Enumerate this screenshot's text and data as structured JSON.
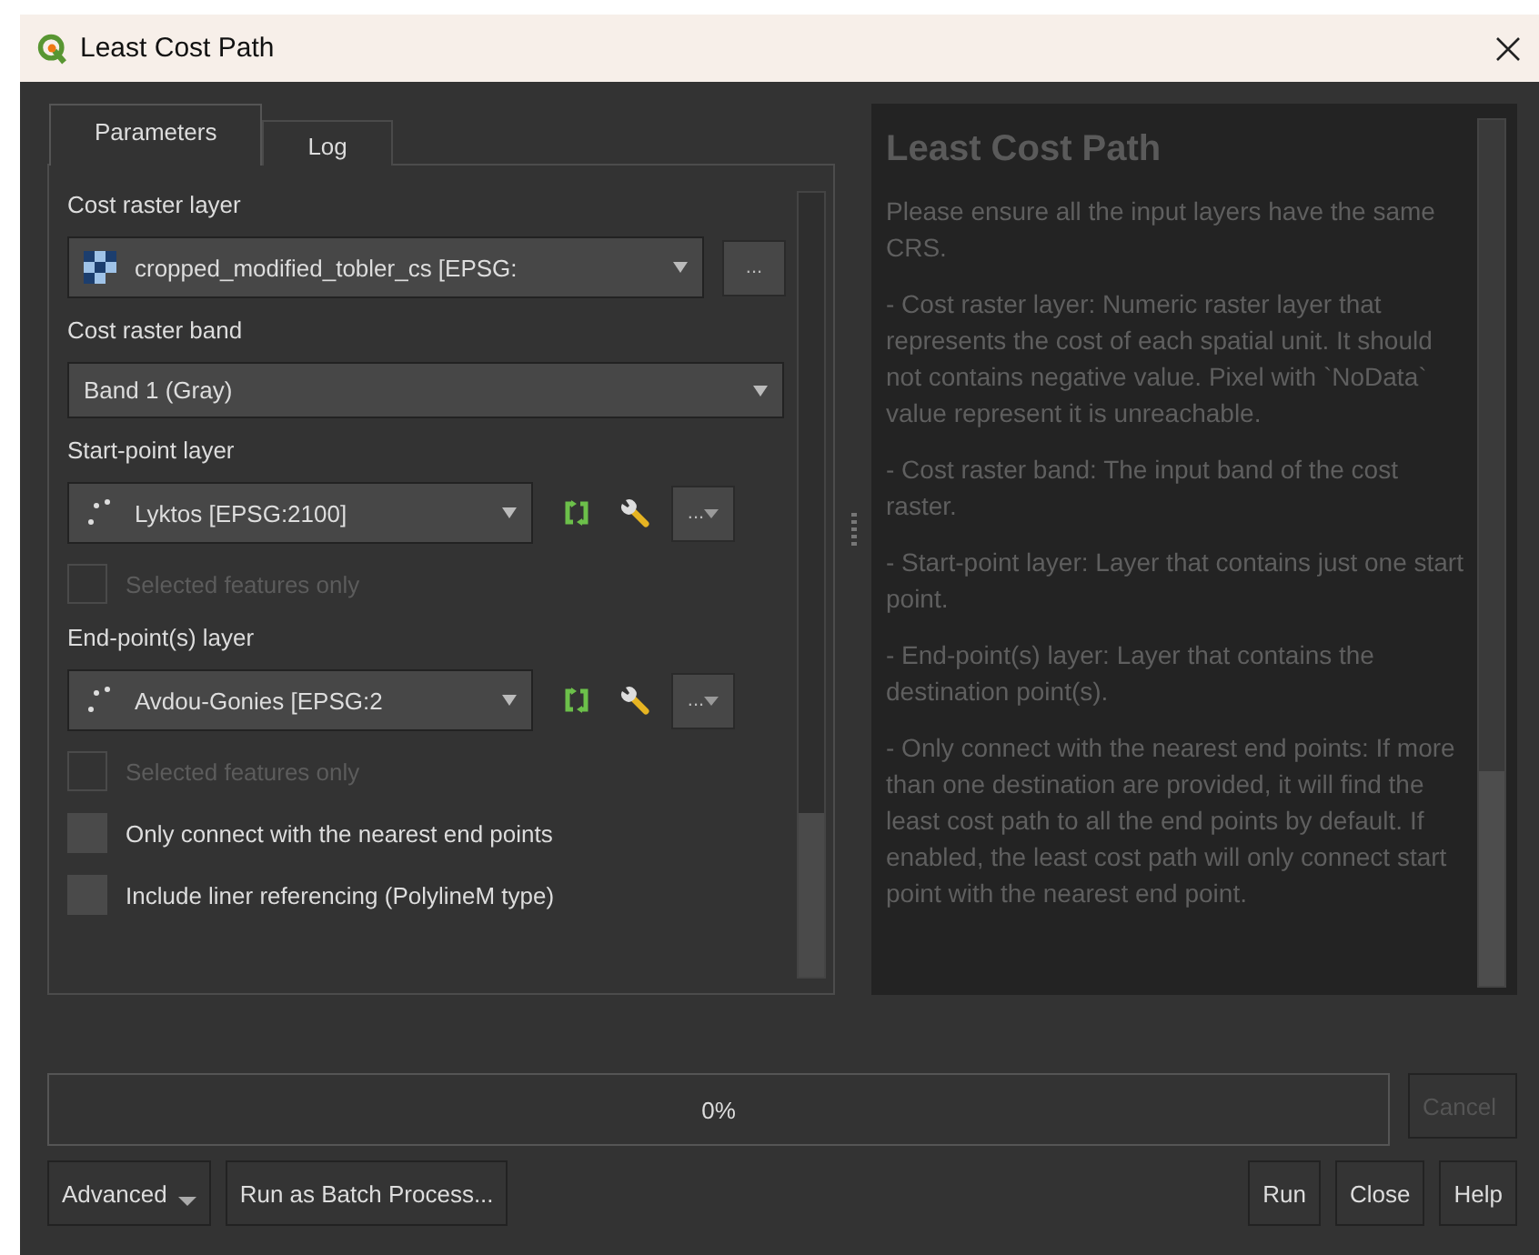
{
  "window": {
    "title": "Least Cost Path"
  },
  "tabs": [
    {
      "label": "Parameters",
      "selected": true
    },
    {
      "label": "Log",
      "selected": false
    }
  ],
  "parameters": [
    {
      "kind": "label",
      "text": "Cost raster layer"
    },
    {
      "kind": "raster_layer",
      "value": "cropped_modified_tobler_cs [EPSG:",
      "button": "..."
    },
    {
      "kind": "label",
      "text": "Cost raster band"
    },
    {
      "kind": "combo",
      "value": "Band 1 (Gray)"
    },
    {
      "kind": "label",
      "text": "Start-point layer"
    },
    {
      "kind": "vector_layer",
      "value": "Lyktos [EPSG:2100]",
      "button": "..."
    },
    {
      "kind": "checkbox",
      "text": "Selected features only",
      "checked": false,
      "disabled": true
    },
    {
      "kind": "label",
      "text": "End-point(s) layer"
    },
    {
      "kind": "vector_layer",
      "value": "Avdou-Gonies [EPSG:2",
      "button": "..."
    },
    {
      "kind": "checkbox",
      "text": "Selected features only",
      "checked": false,
      "disabled": true
    },
    {
      "kind": "checkbox",
      "text": "Only connect with the nearest end points",
      "checked": false,
      "disabled": false
    },
    {
      "kind": "checkbox",
      "text": "Include liner referencing (PolylineM type)",
      "checked": false,
      "disabled": false
    }
  ],
  "help": {
    "title": "Least Cost Path",
    "paragraphs": [
      "Please ensure all the input layers have the same CRS.",
      "- Cost raster layer: Numeric raster layer that represents the cost of each spatial unit. It should not contains negative value. Pixel with `NoData` value represent it is unreachable.",
      "- Cost raster band: The input band of the cost raster.",
      "- Start-point layer: Layer that contains just one start point.",
      "- End-point(s) layer: Layer that contains the destination point(s).",
      "- Only connect with the nearest end points: If more than one destination are provided, it will find the least cost path to all the end points by default. If enabled, the least cost path will only connect start point with the nearest end point."
    ]
  },
  "progress": {
    "label": "0%",
    "level": 0
  },
  "cancel_button": {
    "label": "Cancel",
    "disabled": true
  },
  "left_buttons": [
    {
      "label": "Advanced",
      "kind": "menu"
    },
    {
      "label": "Run as Batch Process...",
      "kind": "plain"
    }
  ],
  "right_buttons": [
    "Run",
    "Close",
    "Help"
  ]
}
